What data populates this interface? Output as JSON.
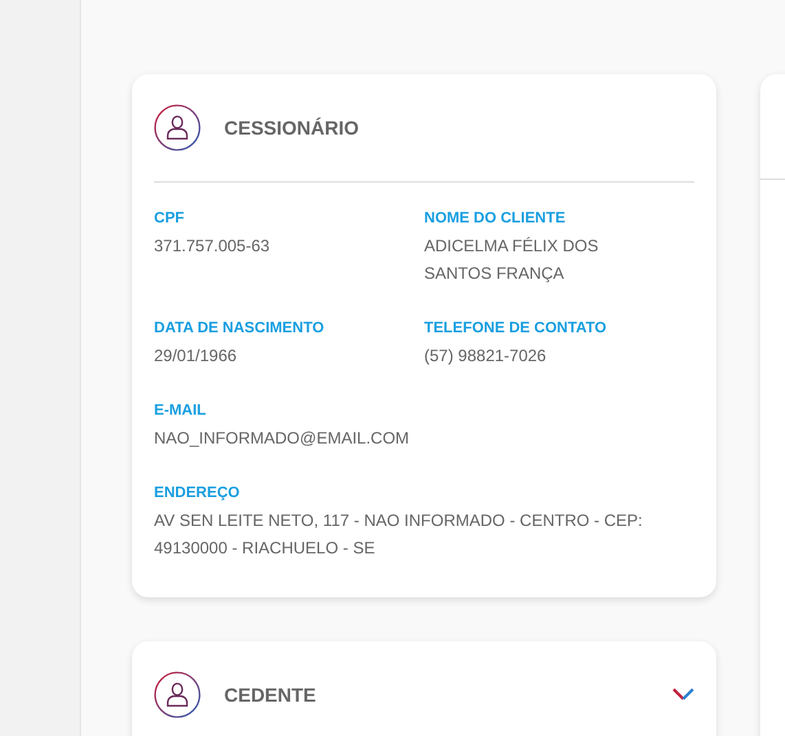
{
  "cards": [
    {
      "title": "CESSIONÁRIO",
      "expanded": true,
      "rows": [
        [
          {
            "label": "CPF",
            "value": "371.757.005-63"
          },
          {
            "label": "NOME DO CLIENTE",
            "value": "ADICELMA FÉLIX DOS SANTOS FRANÇA"
          }
        ],
        [
          {
            "label": "DATA DE NASCIMENTO",
            "value": "29/01/1966"
          },
          {
            "label": "TELEFONE DE CONTATO",
            "value": "(57) 98821-7026"
          }
        ],
        [
          {
            "label": "E-MAIL",
            "value": "NAO_INFORMADO@EMAIL.COM"
          }
        ],
        [
          {
            "label": "ENDEREÇO",
            "value": "AV SEN LEITE NETO, 117 - NAO INFORMADO - CENTRO - CEP: 49130000 - RIACHUELO - SE"
          }
        ]
      ]
    },
    {
      "title": "CEDENTE",
      "expanded": false
    }
  ]
}
